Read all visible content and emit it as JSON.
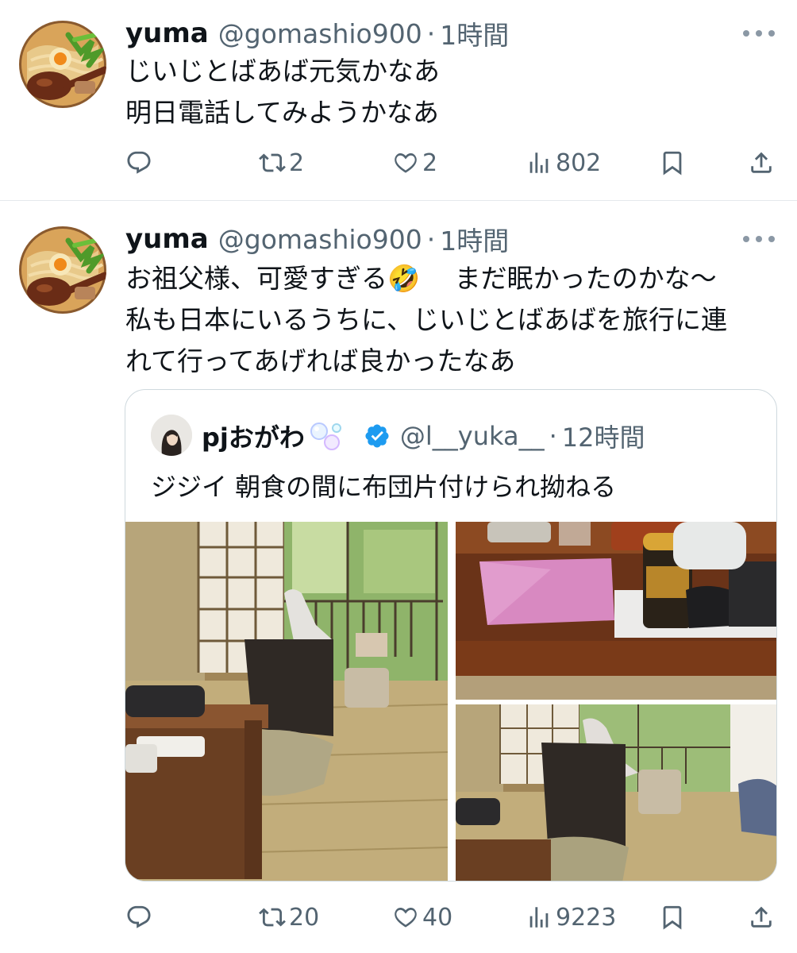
{
  "tweets": [
    {
      "author": {
        "name": "yuma",
        "handle": "@gomashio900"
      },
      "separator": "·",
      "time": "1時間",
      "lines": [
        "じいじとばあば元気かなあ",
        "明日電話してみようかなあ"
      ],
      "stats": {
        "replies": "",
        "retweets": "2",
        "likes": "2",
        "views": "802"
      }
    },
    {
      "author": {
        "name": "yuma",
        "handle": "@gomashio900"
      },
      "separator": "·",
      "time": "1時間",
      "lines": [
        "お祖父様、可愛すぎる🤣　 まだ眠かったのかな〜",
        "私も日本にいるうちに、じいじとばあばを旅行に連",
        "れて行ってあげれば良かったなあ"
      ],
      "stats": {
        "replies": "",
        "retweets": "20",
        "likes": "40",
        "views": "9223"
      },
      "quote": {
        "author": {
          "name": "pjおがわ",
          "handle": "@l__yuka__"
        },
        "separator": "·",
        "time": "12時間",
        "text": "ジジイ 朝食の間に布団片付けられ拗ねる"
      }
    }
  ],
  "icons": [
    "more-icon",
    "reply-icon",
    "retweet-icon",
    "like-icon",
    "views-icon",
    "bookmark-icon",
    "share-icon",
    "verified-badge-icon",
    "bubbles-icon"
  ],
  "colors": {
    "text": "#0f1419",
    "secondary": "#536471",
    "verified": "#1d9bf0",
    "divider": "#e5e9ec",
    "border": "#cfd9de"
  }
}
